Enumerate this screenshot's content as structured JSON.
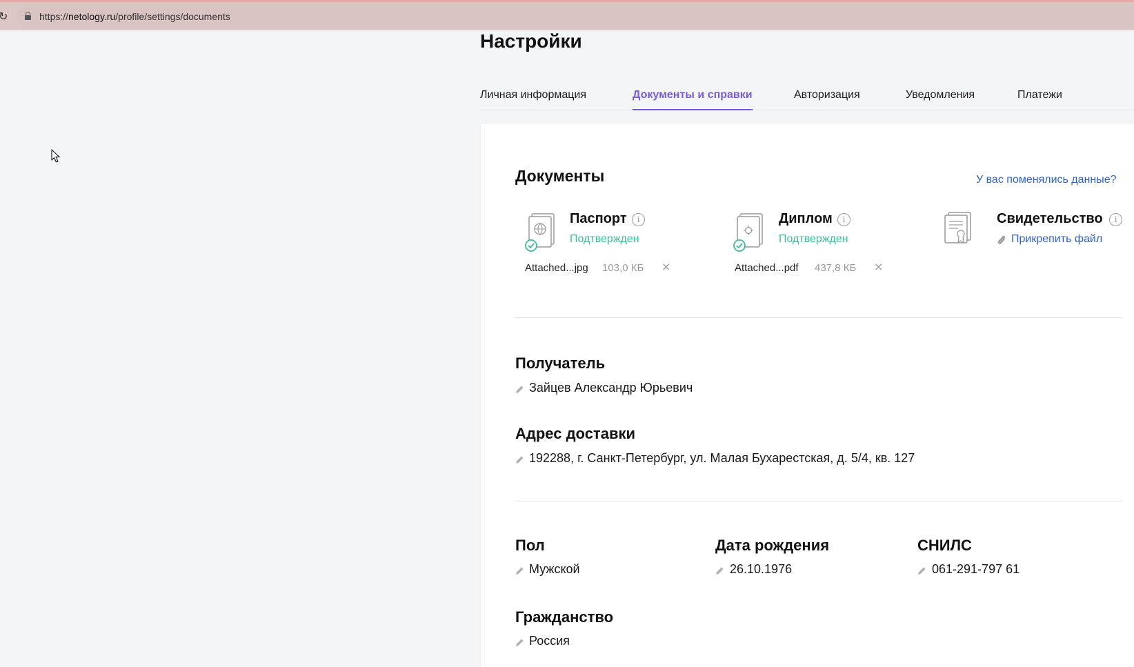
{
  "browser": {
    "url_prefix": "https://",
    "url_host": "netology.ru",
    "url_path": "/profile/settings/documents",
    "reload_icon": "reload-icon",
    "lock_icon": "lock-icon"
  },
  "page": {
    "title": "Настройки"
  },
  "tabs": [
    {
      "label": "Личная информация",
      "active": false
    },
    {
      "label": "Документы и справки",
      "active": true
    },
    {
      "label": "Авторизация",
      "active": false
    },
    {
      "label": "Уведомления",
      "active": false
    },
    {
      "label": "Платежи",
      "active": false
    }
  ],
  "documents": {
    "heading": "Документы",
    "changed_link": "У вас поменялись данные?",
    "items": [
      {
        "title": "Паспорт",
        "status": "Подтвержден",
        "icon": "passport-icon",
        "file_name": "Attached...jpg",
        "file_size": "103,0 КБ"
      },
      {
        "title": "Диплом",
        "status": "Подтвержден",
        "icon": "diploma-icon",
        "file_name": "Attached...pdf",
        "file_size": "437,8 КБ"
      },
      {
        "title": "Свидетельство",
        "attach_label": "Прикрепить файл",
        "icon": "certificate-icon"
      }
    ]
  },
  "recipient": {
    "heading": "Получатель",
    "value": "Зайцев Александр Юрьевич"
  },
  "delivery": {
    "heading": "Адрес доставки",
    "value": "192288, г. Санкт-Петербург, ул. Малая Бухарестская, д. 5/4, кв. 127"
  },
  "personal": {
    "gender": {
      "heading": "Пол",
      "value": "Мужской"
    },
    "birth_date": {
      "heading": "Дата рождения",
      "value": "26.10.1976"
    },
    "snils": {
      "heading": "СНИЛС",
      "value": "061-291-797 61"
    },
    "citizenship": {
      "heading": "Гражданство",
      "value": "Россия"
    }
  },
  "colors": {
    "accent": "#7a5cd6",
    "link": "#2f62c9",
    "status_ok": "#3dbd93"
  }
}
